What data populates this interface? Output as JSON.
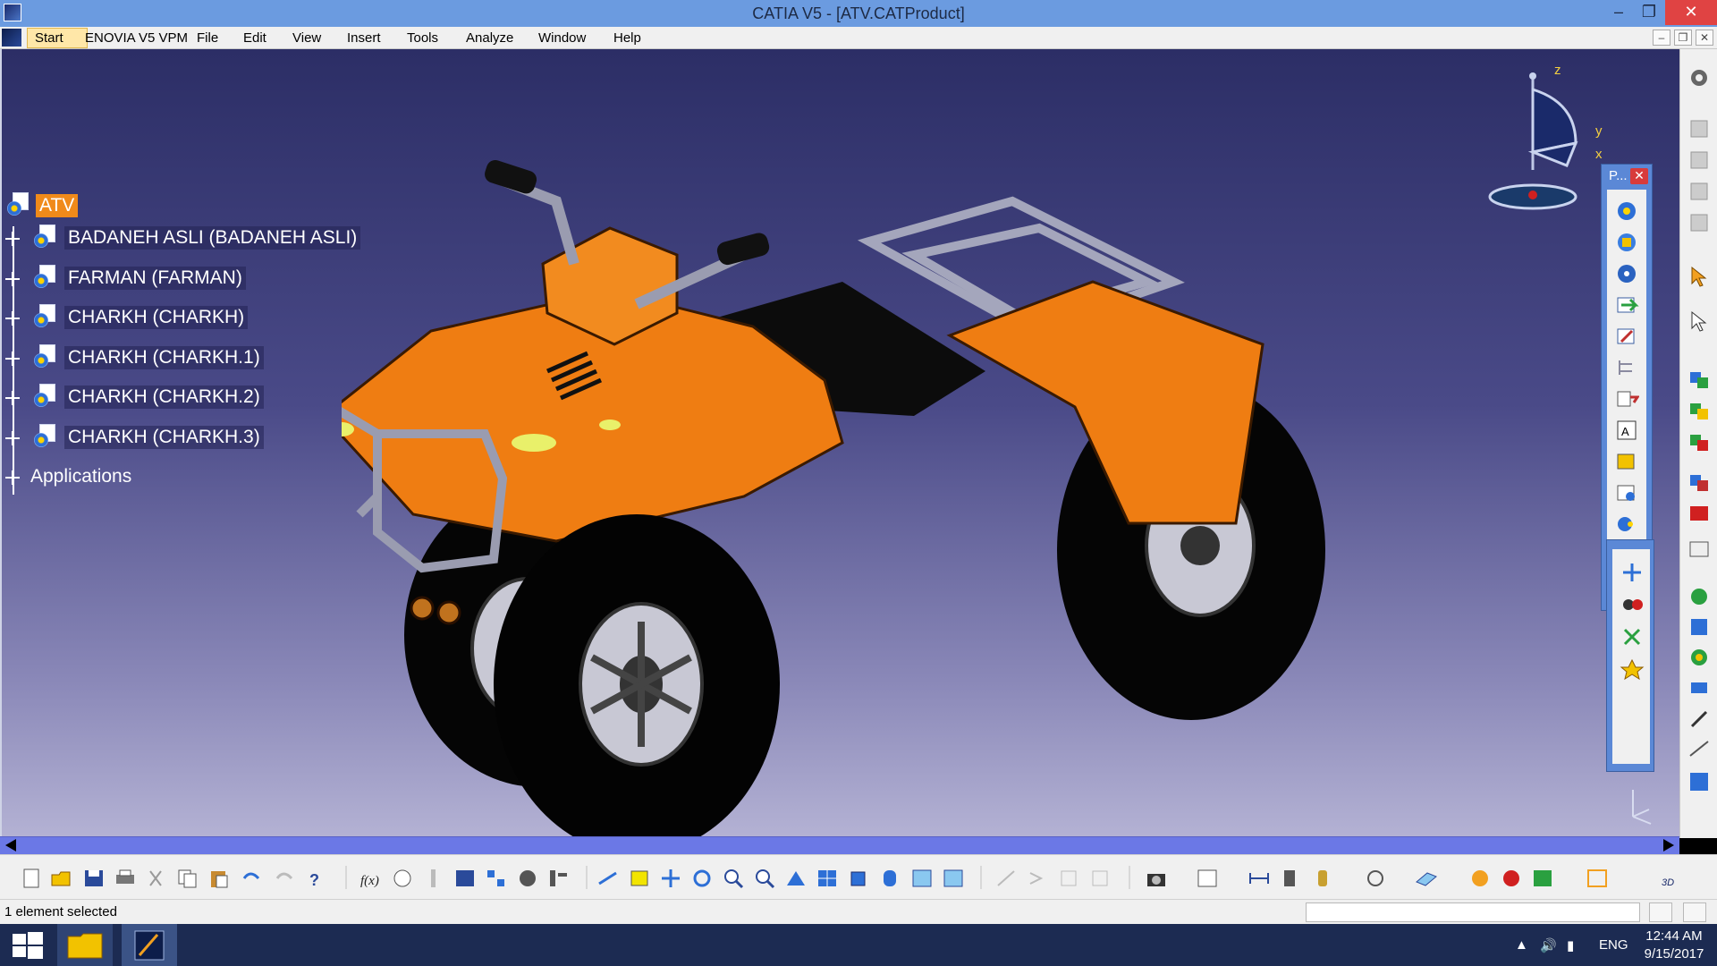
{
  "window": {
    "title": "CATIA V5 - [ATV.CATProduct]",
    "minimize_glyph": "–",
    "restore_glyph": "❐",
    "close_glyph": "✕"
  },
  "menubar": {
    "items": [
      "Start",
      "ENOVIA V5 VPM",
      "File",
      "Edit",
      "View",
      "Insert",
      "Tools",
      "Analyze",
      "Window",
      "Help"
    ]
  },
  "tree": {
    "root": "ATV",
    "children": [
      "BADANEH ASLI (BADANEH ASLI)",
      "FARMAN (FARMAN)",
      "CHARKH (CHARKH)",
      "CHARKH (CHARKH.1)",
      "CHARKH (CHARKH.2)",
      "CHARKH (CHARKH.3)"
    ],
    "applications": "Applications"
  },
  "compass": {
    "z": "z",
    "y": "y",
    "x": "x"
  },
  "floating_toolbar": {
    "title": "P...",
    "close": "✕"
  },
  "status": {
    "text": "1 element selected"
  },
  "taskbar": {
    "language": "ENG",
    "time": "12:44 AM",
    "date": "9/15/2017"
  },
  "colors": {
    "titlebar": "#6b9be0",
    "viewport_top": "#2c2e66",
    "viewport_bottom": "#b4b2d4",
    "selection": "#f08a1a",
    "atv_body": "#ef7d12",
    "taskbar": "#1c2b52"
  }
}
